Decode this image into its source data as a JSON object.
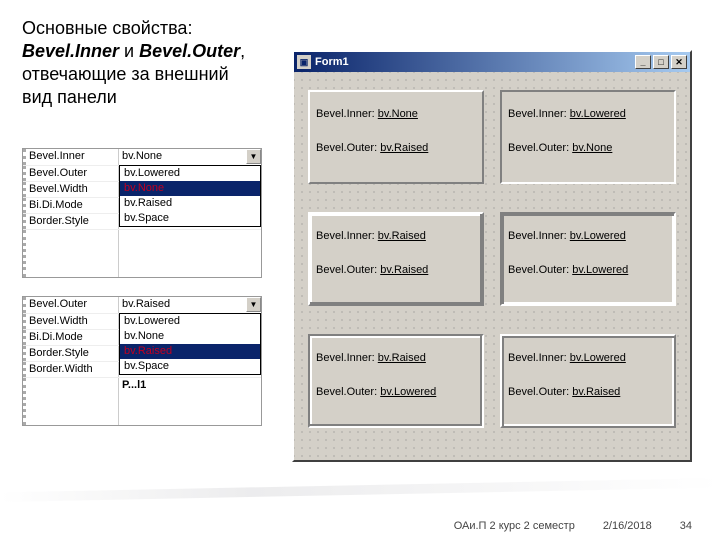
{
  "heading": {
    "prefix": "Основные свойства:",
    "italic1": "Bevel.Inner",
    "conj": " и ",
    "italic2": "Bevel.Outer",
    "comma": ",",
    "line2": "отвечающие за внешний",
    "line3": "вид панели"
  },
  "grid1": {
    "rows": [
      {
        "l": "Bevel.Inner",
        "r": "bv.None"
      },
      {
        "l": "Bevel.Outer",
        "r": "bv.Lowered"
      },
      {
        "l": "Bevel.Width",
        "r": ""
      },
      {
        "l": "Bi.Di.Mode",
        "r": ""
      },
      {
        "l": "Border.Style",
        "r": ""
      }
    ],
    "dropdown": [
      "bv.Lowered",
      "bv.None",
      "bv.Raised",
      "bv.Space"
    ],
    "selected": "bv.None"
  },
  "grid2": {
    "rows": [
      {
        "l": "Bevel.Outer",
        "r": "bv.Raised"
      },
      {
        "l": "Bevel.Width",
        "r": ""
      },
      {
        "l": "Bi.Di.Mode",
        "r": ""
      },
      {
        "l": "Border.Style",
        "r": ""
      },
      {
        "l": "Border.Width",
        "r": ""
      }
    ],
    "dropdown": [
      "bv.Lowered",
      "bv.None",
      "bv.Raised",
      "bv.Space"
    ],
    "selected": "bv.Raised",
    "extra": "P...l1"
  },
  "form": {
    "title": "Form1",
    "panels": [
      {
        "bi_label": "Bevel.Inner:",
        "bi": "bv.None",
        "bo_label": "Bevel.Outer:",
        "bo": "bv.Raised",
        "cls": "bv-raised"
      },
      {
        "bi_label": "Bevel.Inner:",
        "bi": "bv.Lowered",
        "bo_label": "Bevel.Outer:",
        "bo": "bv.None",
        "cls": "bv-lowered"
      },
      {
        "bi_label": "Bevel.Inner:",
        "bi": "bv.Raised",
        "bo_label": "Bevel.Outer:",
        "bo": "bv.Raised",
        "cls": "bv-raised"
      },
      {
        "bi_label": "Bevel.Inner:",
        "bi": "bv.Lowered",
        "bo_label": "Bevel.Outer:",
        "bo": "bv.Lowered",
        "cls": "bv-lowered"
      },
      {
        "bi_label": "Bevel.Inner:",
        "bi": "bv.Raised",
        "bo_label": "Bevel.Outer:",
        "bo": "bv.Lowered",
        "cls": "bv-raised"
      },
      {
        "bi_label": "Bevel.Inner:",
        "bi": "bv.Lowered",
        "bo_label": "Bevel.Outer:",
        "bo": "bv.Raised",
        "cls": "bv-raised"
      }
    ]
  },
  "footer": {
    "course": "ОАи.П 2 курс 2 семестр",
    "date": "2/16/2018",
    "page": "34"
  }
}
